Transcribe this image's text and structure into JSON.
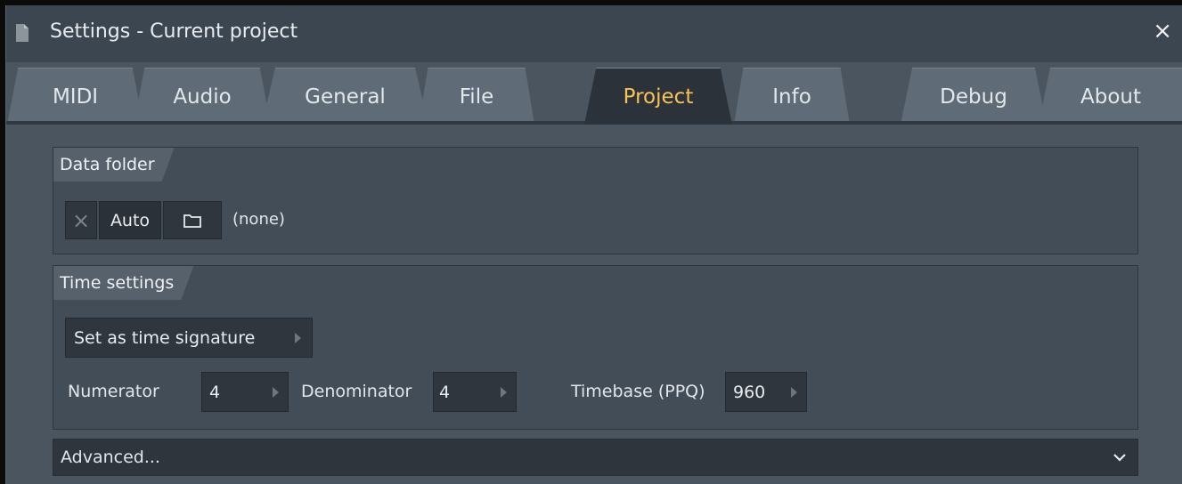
{
  "window": {
    "title": "Settings - Current project",
    "close_glyph": "×"
  },
  "tabs": [
    {
      "label": "MIDI"
    },
    {
      "label": "Audio"
    },
    {
      "label": "General"
    },
    {
      "label": "File"
    },
    {
      "label": "Project",
      "active": true
    },
    {
      "label": "Info"
    },
    {
      "label": "Debug"
    },
    {
      "label": "About"
    }
  ],
  "data_folder": {
    "header": "Data folder",
    "clear_glyph": "×",
    "auto_label": "Auto",
    "folder_icon": "folder-icon",
    "path_value": "(none)"
  },
  "time_settings": {
    "header": "Time settings",
    "set_as_label": "Set as time signature",
    "numerator_label": "Numerator",
    "numerator_value": "4",
    "denominator_label": "Denominator",
    "denominator_value": "4",
    "timebase_label": "Timebase (PPQ)",
    "timebase_value": "960"
  },
  "advanced": {
    "label": "Advanced..."
  },
  "colors": {
    "accent_active_tab": "#f8c254",
    "window_bg": "#4a5560",
    "panel_bg": "#434d57"
  }
}
